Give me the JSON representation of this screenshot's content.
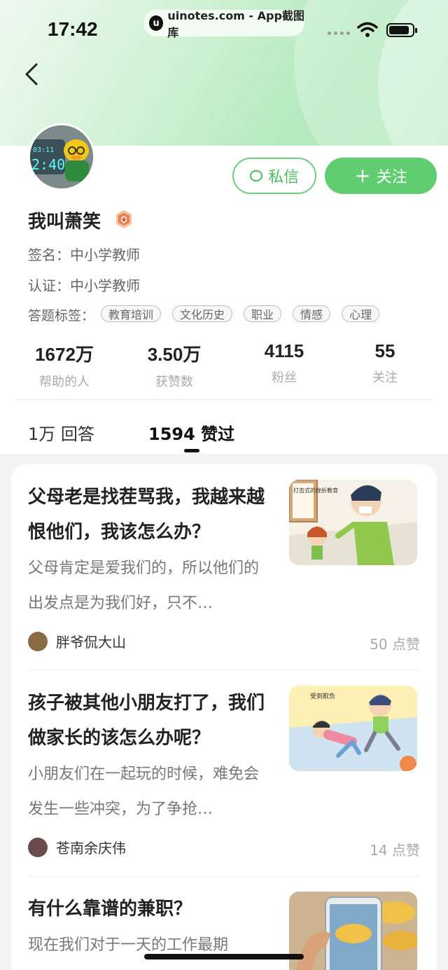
{
  "status": {
    "time": "17:42",
    "watermark": "uinotes.com - App截图库",
    "watermark_logo": "u"
  },
  "profile": {
    "name": "我叫萧笑",
    "signature_label": "签名：",
    "signature": "中小学教师",
    "cert_label": "认证：",
    "cert": "中小学教师",
    "tags_label": "答题标签：",
    "tags": [
      "教育培训",
      "文化历史",
      "职业",
      "情感",
      "心理"
    ],
    "avatar_clock": [
      "03:11",
      "2:40"
    ]
  },
  "buttons": {
    "message": "私信",
    "follow_plus": "+",
    "follow": "关注"
  },
  "stats": [
    {
      "num": "1672万",
      "label": "帮助的人"
    },
    {
      "num": "3.50万",
      "label": "获赞数"
    },
    {
      "num": "4115",
      "label": "粉丝"
    },
    {
      "num": "55",
      "label": "关注"
    }
  ],
  "tabs": [
    {
      "label": "1万 回答"
    },
    {
      "label": "1594 赞过"
    }
  ],
  "items": [
    {
      "title": "父母老是找茬骂我，我越来越恨他们，我该怎么办？",
      "excerpt": "父母肯定是爱我们的，所以他们的出发点是为我们好，只不…",
      "author": "胖爷侃大山",
      "likes": "50 点赞",
      "thumb_caption": "打击式的挫折教育"
    },
    {
      "title": "孩子被其他小朋友打了，我们做家长的该怎么办呢？",
      "excerpt": "小朋友们在一起玩的时候，难免会发生一些冲突，为了争抢…",
      "author": "苍南余庆伟",
      "likes": "14 点赞",
      "thumb_caption": "受到欺负"
    },
    {
      "title": "有什么靠谱的兼职？",
      "excerpt": "现在我们对于一天的工作最期"
    }
  ],
  "colors": {
    "accent": "#5fcd70",
    "hero_gradient": [
      "#eef9ee",
      "#a9e6b5"
    ]
  }
}
